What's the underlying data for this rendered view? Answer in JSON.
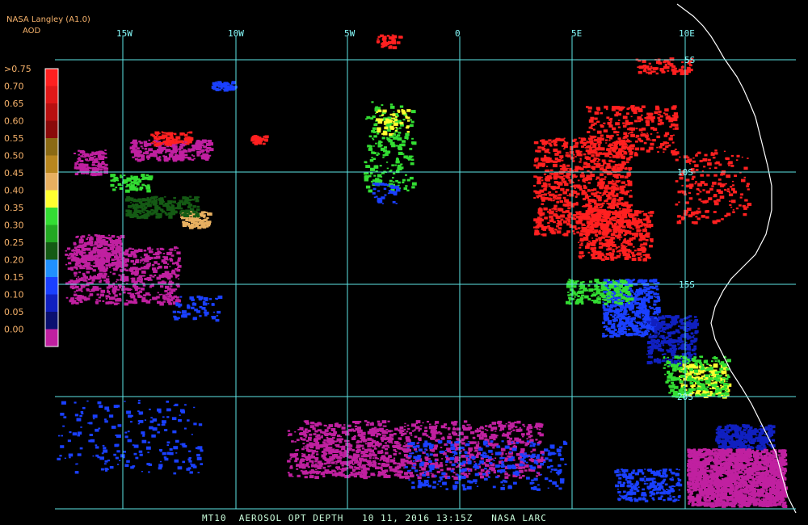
{
  "header": {
    "source": "NASA Langley (A1.0)",
    "product": "AOD"
  },
  "footer": {
    "text": "MT10  AEROSOL OPT DEPTH   10 11, 2016 13:15Z   NASA LARC"
  },
  "longitude_labels": [
    "15W",
    "10W",
    "5W",
    "0",
    "5E",
    "10E"
  ],
  "latitude_labels": [
    "5S",
    "10S",
    "15S",
    "20S"
  ],
  "color_scale": {
    "labels": [
      ">0.75",
      "0.70",
      "0.65",
      "0.60",
      "0.55",
      "0.50",
      "0.45",
      "0.40",
      "0.35",
      "0.30",
      "0.25",
      "0.20",
      "0.15",
      "0.10",
      "0.05",
      "0.00"
    ],
    "colors": [
      "#ff2020",
      "#e01818",
      "#b81010",
      "#8a0a0a",
      "#8b6a14",
      "#b8861e",
      "#e8b060",
      "#ffff30",
      "#33dd33",
      "#22a822",
      "#145a14",
      "#2090ff",
      "#1a40ff",
      "#1020c0",
      "#0a1070",
      "#c020a0"
    ]
  },
  "colors": {
    "grid": "#5ee6e6",
    "coast": "#ffffff",
    "background": "#000000"
  }
}
